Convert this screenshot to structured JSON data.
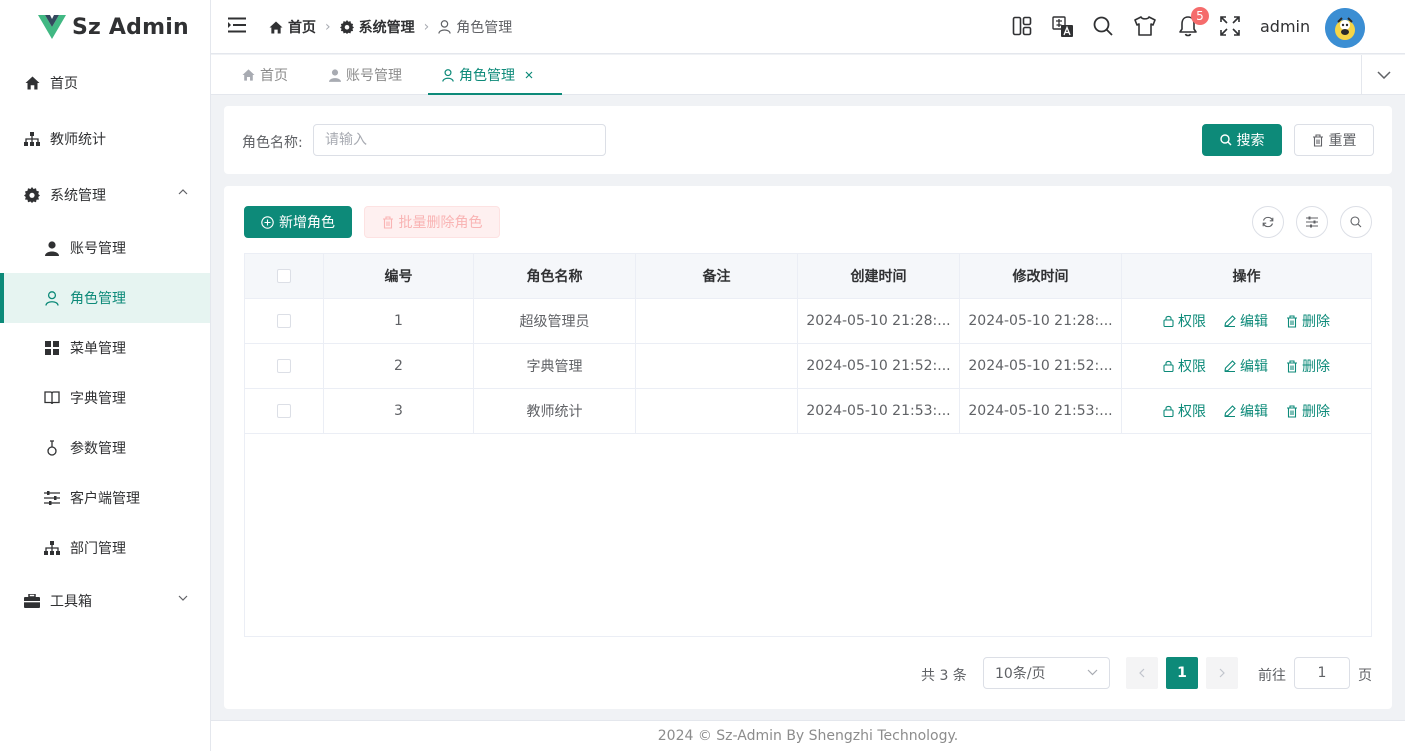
{
  "app": {
    "name": "Sz Admin"
  },
  "colors": {
    "primary": "#0d8a79",
    "danger": "#f56c6c",
    "active_bg": "#e6f4f1"
  },
  "sidebar": {
    "items": [
      {
        "label": "首页",
        "icon": "home-icon"
      },
      {
        "label": "教师统计",
        "icon": "org-chart-icon"
      },
      {
        "label": "系统管理",
        "icon": "gear-icon",
        "expanded": true
      },
      {
        "label": "账号管理",
        "icon": "user-filled-icon"
      },
      {
        "label": "角色管理",
        "icon": "user-outline-icon",
        "active": true
      },
      {
        "label": "菜单管理",
        "icon": "grid-icon"
      },
      {
        "label": "字典管理",
        "icon": "book-icon"
      },
      {
        "label": "参数管理",
        "icon": "param-icon"
      },
      {
        "label": "客户端管理",
        "icon": "sliders-icon"
      },
      {
        "label": "部门管理",
        "icon": "org-chart-icon"
      },
      {
        "label": "工具箱",
        "icon": "briefcase-icon",
        "expanded": false
      }
    ]
  },
  "header": {
    "breadcrumb": [
      "首页",
      "系统管理",
      "角色管理"
    ],
    "notification_count": "5",
    "username": "admin"
  },
  "tabs": [
    {
      "label": "首页"
    },
    {
      "label": "账号管理"
    },
    {
      "label": "角色管理",
      "active": true
    }
  ],
  "search": {
    "label": "角色名称:",
    "placeholder": "请输入",
    "search_label": "搜索",
    "reset_label": "重置"
  },
  "toolbar": {
    "add_label": "新增角色",
    "batch_delete_label": "批量删除角色"
  },
  "table": {
    "columns": [
      "编号",
      "角色名称",
      "备注",
      "创建时间",
      "修改时间",
      "操作"
    ],
    "rows": [
      {
        "id": "1",
        "name": "超级管理员",
        "remark": "",
        "created": "2024-05-10 21:28:...",
        "modified": "2024-05-10 21:28:..."
      },
      {
        "id": "2",
        "name": "字典管理",
        "remark": "",
        "created": "2024-05-10 21:52:...",
        "modified": "2024-05-10 21:52:..."
      },
      {
        "id": "3",
        "name": "教师统计",
        "remark": "",
        "created": "2024-05-10 21:53:...",
        "modified": "2024-05-10 21:53:..."
      }
    ],
    "actions": {
      "permission": "权限",
      "edit": "编辑",
      "delete": "删除"
    }
  },
  "pagination": {
    "total_text": "共 3 条",
    "page_size": "10条/页",
    "current_page": "1",
    "goto_label": "前往",
    "goto_value": "1",
    "page_suffix": "页"
  },
  "footer": {
    "text": "2024 © Sz-Admin By Shengzhi Technology."
  }
}
